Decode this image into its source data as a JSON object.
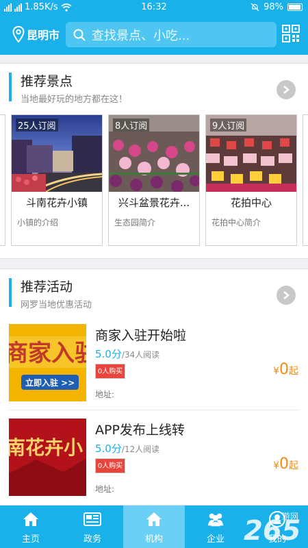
{
  "status_bar": {
    "network_speed": "1.85K/s",
    "time": "16:32",
    "battery": "98%"
  },
  "header": {
    "city": "昆明市",
    "search_placeholder": "查找景点、小吃..."
  },
  "recommended_spots": {
    "title": "推荐景点",
    "subtitle": "当地最好玩的地方都在这！",
    "items": [
      {
        "subscribers": "25人订阅",
        "name": "斗南花卉小镇",
        "desc": "小镇的介绍"
      },
      {
        "subscribers": "8人订阅",
        "name": "兴斗盆景花卉...",
        "desc": "生态园简介"
      },
      {
        "subscribers": "9人订阅",
        "name": "花拍中心",
        "desc": "花拍中心简介"
      }
    ]
  },
  "recommended_activities": {
    "title": "推荐活动",
    "subtitle": "网罗当地优惠活动",
    "items": [
      {
        "title": "商家入驻开始啦",
        "score": "5.0分",
        "reads": "/34人阅读",
        "buy": "0人购买",
        "address": "地址:",
        "currency": "¥",
        "price": "0",
        "price_suffix": "起",
        "thumb_text": "商家入驻",
        "thumb_button": "立即入驻 >>"
      },
      {
        "title": "APP发布上线转",
        "score": "5.0分",
        "reads": "/12人阅读",
        "buy": "0人购买",
        "address": "地址:",
        "currency": "¥",
        "price": "0",
        "price_suffix": "起",
        "thumb_text": "南花卉小"
      }
    ]
  },
  "tabbar": {
    "tabs": [
      {
        "label": "主页",
        "icon": "home-icon"
      },
      {
        "label": "政务",
        "icon": "newspaper-icon"
      },
      {
        "label": "机构",
        "icon": "home-icon",
        "active": true
      },
      {
        "label": "企业",
        "icon": "people-icon"
      },
      {
        "label": "我的",
        "icon": "user-icon"
      }
    ]
  },
  "watermark": {
    "text": "265",
    "sub": "游网"
  },
  "colors": {
    "primary": "#1ab1ea",
    "accent_orange": "#f08a10",
    "buy_red": "#e8443b"
  }
}
